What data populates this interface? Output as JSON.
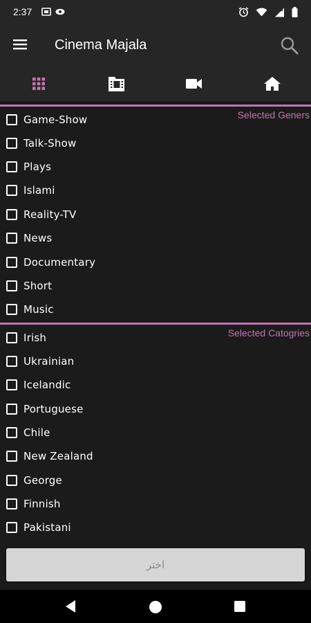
{
  "status_bar": {
    "time": "2:37"
  },
  "app_bar": {
    "title": "Cinema Majala"
  },
  "colors": {
    "accent": "#c474b2",
    "background": "#1b1b1b",
    "bar": "#262626",
    "button": "#d6d6d6"
  },
  "tabs": [
    {
      "icon": "grid-icon",
      "active": true
    },
    {
      "icon": "movie-folder-icon",
      "active": false
    },
    {
      "icon": "videocam-icon",
      "active": false
    },
    {
      "icon": "home-icon",
      "active": false
    }
  ],
  "genres": {
    "label": "Selected Geners",
    "items": [
      "Game-Show",
      "Talk-Show",
      "Plays",
      "Islami",
      "Reality-TV",
      "News",
      "Documentary",
      "Short",
      "Music"
    ]
  },
  "categories": {
    "label": "Selected Catogries",
    "items": [
      "Irish",
      "Ukrainian",
      "Icelandic",
      "Portuguese",
      "Chile",
      "New Zealand",
      "George",
      "Finnish",
      "Pakistani"
    ]
  },
  "choose_button": {
    "label": "اختر"
  },
  "nav": [
    "back-icon",
    "home-circle-icon",
    "recents-icon"
  ]
}
